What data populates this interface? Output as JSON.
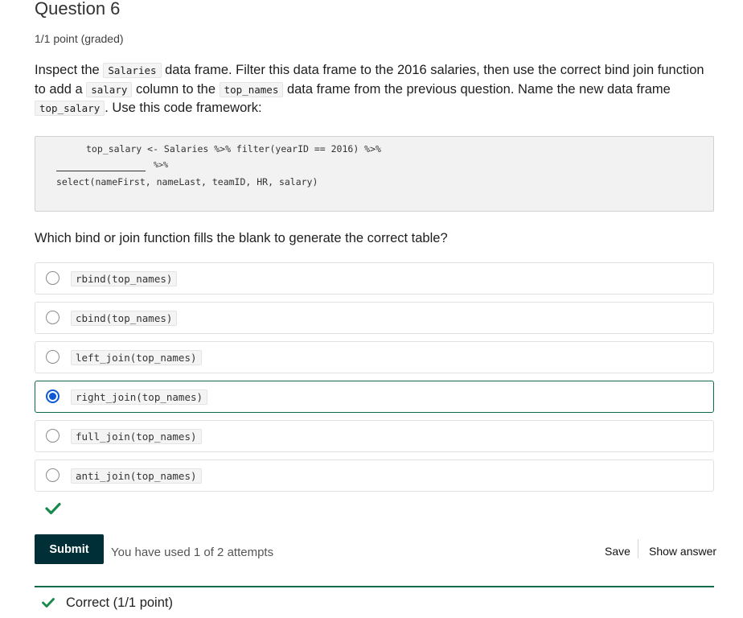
{
  "problem": {
    "title": "Question 6",
    "points": "1/1 point (graded)",
    "prompt": {
      "t1": "Inspect the ",
      "c1": "Salaries",
      "t2": " data frame. Filter this data frame to the 2016 salaries, then use the correct bind join function to add a ",
      "c2": "salary",
      "t3": " column to the ",
      "c3": "top_names",
      "t4": " data frame from the previous question. Name the new data frame ",
      "c4": "top_salary",
      "t5": ". Use this code framework:"
    },
    "code": {
      "line1": "top_salary <- Salaries %>% filter(yearID == 2016) %>%",
      "line2": "%>%",
      "line3": "select(nameFirst, nameLast, teamID, HR, salary)"
    },
    "question": "Which bind or join function fills the blank to generate the correct table?",
    "choices": [
      {
        "label": "rbind(top_names)"
      },
      {
        "label": "cbind(top_names)"
      },
      {
        "label": "left_join(top_names)"
      },
      {
        "label": "right_join(top_names)"
      },
      {
        "label": "full_join(top_names)"
      },
      {
        "label": "anti_join(top_names)"
      }
    ],
    "selected_choice": "right_join(top_names)"
  },
  "actions": {
    "submit": "Submit",
    "attempts": "You have used 1 of 2 attempts",
    "save": "Save",
    "show_answer": "Show answer"
  },
  "feedback": {
    "text": "Correct (1/1 point)",
    "icon": "checkmark-icon"
  },
  "colors": {
    "accent_green": "#0d6b4a",
    "check_green": "#178a4b",
    "radio_blue": "#0e59d6",
    "submit_bg": "#002f37"
  }
}
